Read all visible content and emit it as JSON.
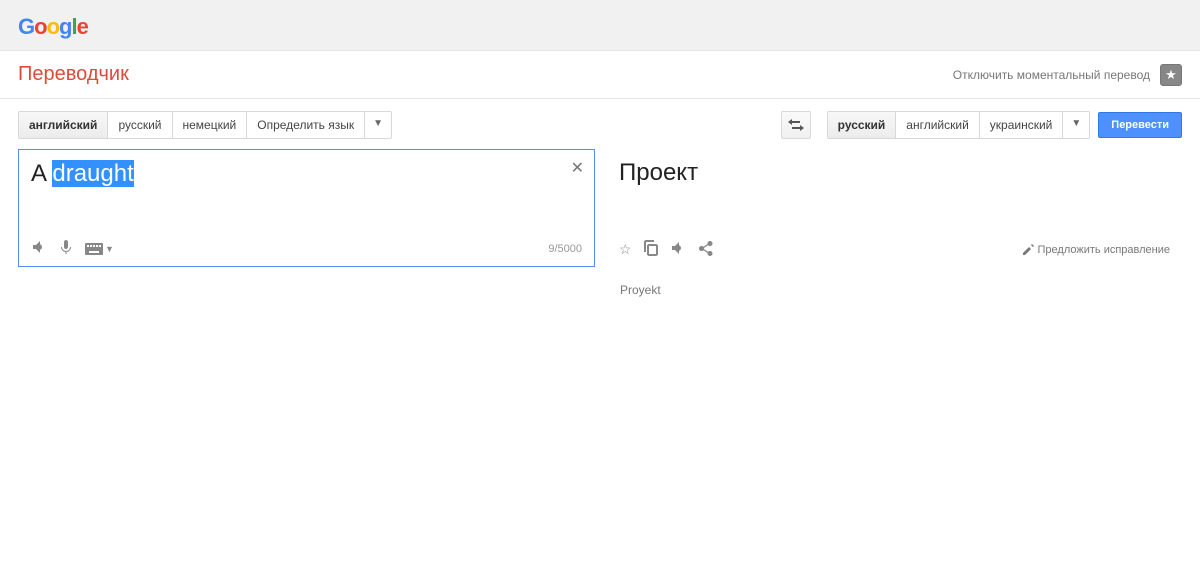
{
  "logo_text": "Google",
  "app_title": "Переводчик",
  "header": {
    "instant_off": "Отключить моментальный перевод"
  },
  "source": {
    "tabs": [
      "английский",
      "русский",
      "немецкий",
      "Определить язык"
    ],
    "active_index": 0,
    "text_prefix": "A ",
    "text_selected": "draught",
    "char_count": "9/5000"
  },
  "target": {
    "tabs": [
      "русский",
      "английский",
      "украинский"
    ],
    "active_index": 0,
    "text": "Проект",
    "transliteration": "Proyekt",
    "suggest_edit": "Предложить исправление"
  },
  "translate_button": "Перевести"
}
